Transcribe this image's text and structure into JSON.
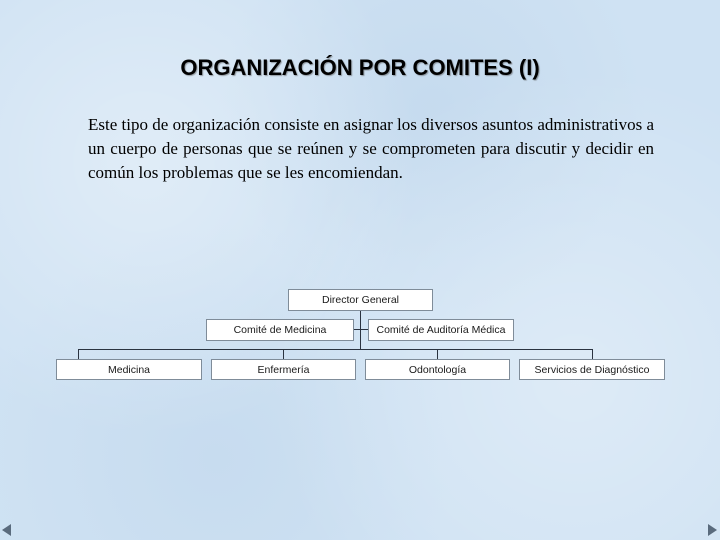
{
  "slide": {
    "title": "ORGANIZACIÓN POR COMITES (I)",
    "paragraph": "Este tipo de organización consiste en asignar los diversos asuntos administrativos a un cuerpo de personas que se reúnen y se comprometen para discutir y decidir en común los problemas que se les encomiendan."
  },
  "org_chart": {
    "top": {
      "label": "Director General"
    },
    "staff": [
      {
        "label": "Comité de Medicina"
      },
      {
        "label": "Comité de Auditoría Médica"
      }
    ],
    "departments": [
      {
        "label": "Medicina"
      },
      {
        "label": "Enfermería"
      },
      {
        "label": "Odontología"
      },
      {
        "label": "Servicios de Diagnóstico"
      }
    ]
  },
  "navigation": {
    "prev_icon": "triangle-left",
    "next_icon": "triangle-right"
  }
}
